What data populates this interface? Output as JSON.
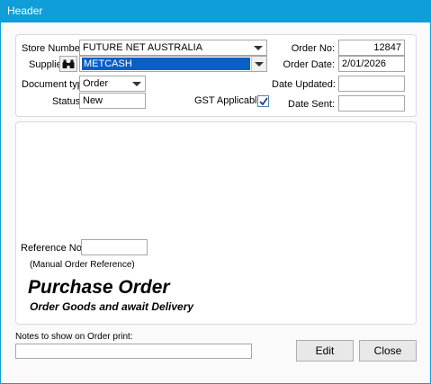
{
  "window": {
    "title": "Header"
  },
  "header_panel": {
    "store_number_label": "Store Number",
    "store_number_value": "FUTURE NET AUSTRALIA",
    "supplier_label": "Supplier",
    "supplier_value": "METCASH",
    "document_type_label": "Document type",
    "document_type_value": "Order",
    "status_label": "Status",
    "status_value": "New",
    "gst_label": "GST Applicable",
    "gst_checked": true,
    "order_no_label": "Order No:",
    "order_no_value": "12847",
    "order_date_label": "Order Date:",
    "order_date_value": "2/01/2026",
    "date_updated_label": "Date Updated:",
    "date_updated_value": "",
    "date_sent_label": "Date Sent:",
    "date_sent_value": ""
  },
  "body_panel": {
    "reference_label": "Reference No:",
    "reference_value": "",
    "reference_hint": "(Manual Order Reference)",
    "doc_title": "Purchase Order",
    "doc_subtitle": "Order Goods and await Delivery"
  },
  "footer": {
    "notes_label": "Notes to show on Order print:",
    "notes_value": "",
    "edit_label": "Edit",
    "close_label": "Close"
  },
  "icons": {
    "supplier_search": "binoculars-icon",
    "gst_check": "checkmark-icon"
  },
  "colors": {
    "titlebar": "#0f9ed8",
    "selection": "#0a5fc4"
  }
}
